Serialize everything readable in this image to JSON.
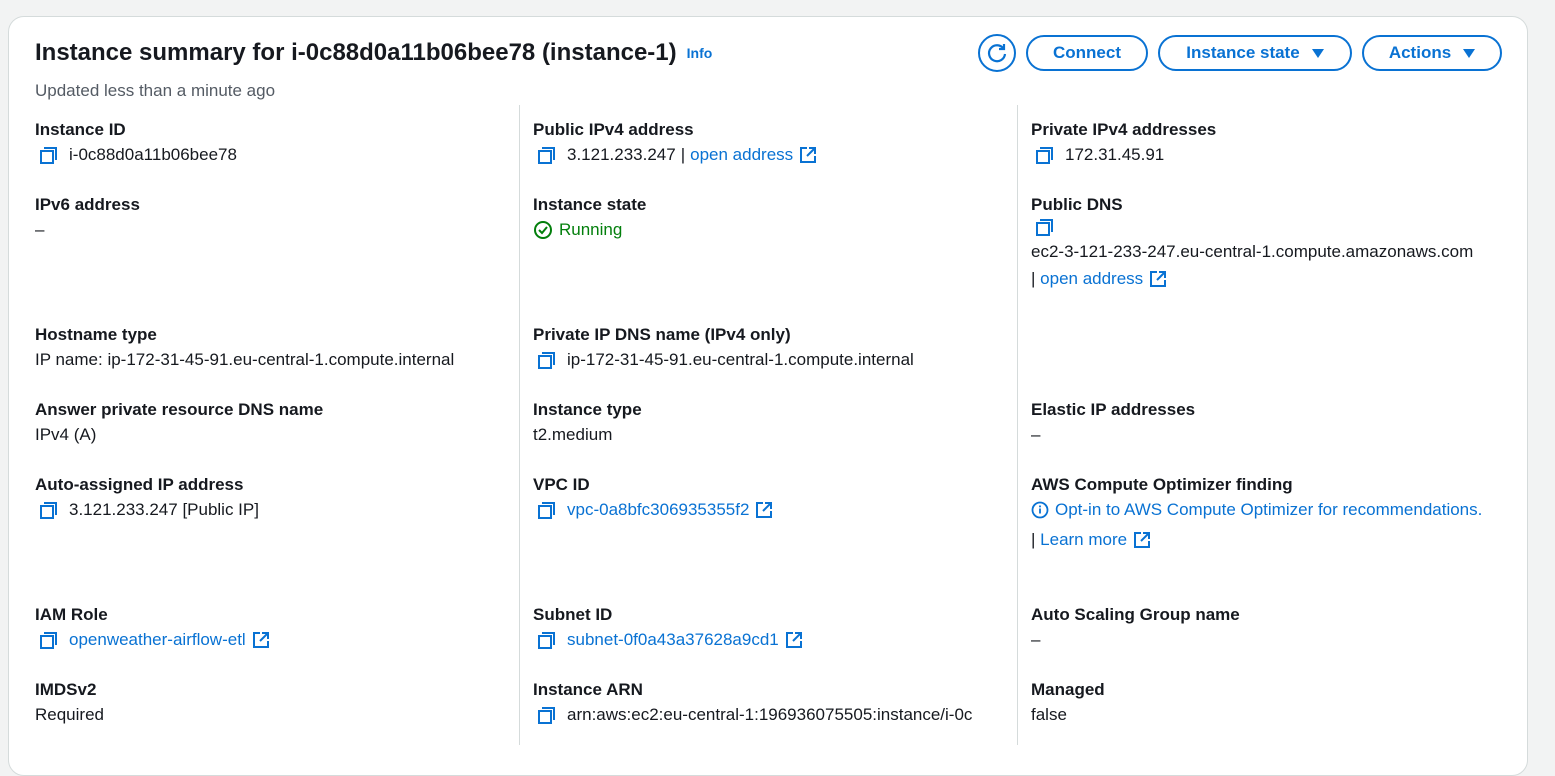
{
  "header": {
    "title": "Instance summary for i-0c88d0a11b06bee78 (instance-1)",
    "info_label": "Info",
    "updated": "Updated less than a minute ago",
    "connect_label": "Connect",
    "instance_state_label": "Instance state",
    "actions_label": "Actions"
  },
  "col1": {
    "instance_id": {
      "label": "Instance ID",
      "value": "i-0c88d0a11b06bee78"
    },
    "ipv6": {
      "label": "IPv6 address",
      "value": "–"
    },
    "hostname_type": {
      "label": "Hostname type",
      "value": "IP name: ip-172-31-45-91.eu-central-1.compute.internal"
    },
    "answer_dns": {
      "label": "Answer private resource DNS name",
      "value": "IPv4 (A)"
    },
    "auto_ip": {
      "label": "Auto-assigned IP address",
      "value": "3.121.233.247 [Public IP]"
    },
    "iam_role": {
      "label": "IAM Role",
      "value": "openweather-airflow-etl"
    },
    "imdsv2": {
      "label": "IMDSv2",
      "value": "Required"
    }
  },
  "col2": {
    "public_ipv4": {
      "label": "Public IPv4 address",
      "value": "3.121.233.247",
      "sep": "|",
      "link": "open address"
    },
    "instance_state": {
      "label": "Instance state",
      "value": "Running"
    },
    "private_dns": {
      "label": "Private IP DNS name (IPv4 only)",
      "value": "ip-172-31-45-91.eu-central-1.compute.internal"
    },
    "instance_type": {
      "label": "Instance type",
      "value": "t2.medium"
    },
    "vpc_id": {
      "label": "VPC ID",
      "value": "vpc-0a8bfc306935355f2"
    },
    "subnet_id": {
      "label": "Subnet ID",
      "value": "subnet-0f0a43a37628a9cd1"
    },
    "instance_arn": {
      "label": "Instance ARN",
      "value": "arn:aws:ec2:eu-central-1:196936075505:instance/i-0c"
    }
  },
  "col3": {
    "private_ipv4": {
      "label": "Private IPv4 addresses",
      "value": "172.31.45.91"
    },
    "public_dns": {
      "label": "Public DNS",
      "value": "ec2-3-121-233-247.eu-central-1.compute.amazonaws.com",
      "sep": "|",
      "link": "open address"
    },
    "elastic_ip": {
      "label": "Elastic IP addresses",
      "value": "–"
    },
    "optimizer": {
      "label": "AWS Compute Optimizer finding",
      "link": "Opt-in to AWS Compute Optimizer for recommendations.",
      "sep": "|",
      "learn_more": "Learn more"
    },
    "asg": {
      "label": "Auto Scaling Group name",
      "value": "–"
    },
    "managed": {
      "label": "Managed",
      "value": "false"
    }
  },
  "colors": {
    "link": "#0972d3",
    "running": "#037f0c",
    "text": "#16191f",
    "muted": "#545b64"
  }
}
